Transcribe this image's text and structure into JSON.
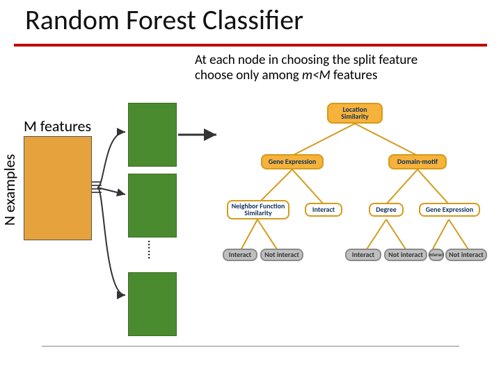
{
  "title": "Random Forest Classifier",
  "subtitle_line1": "At each node in choosing the split feature",
  "subtitle_line2_pre": "choose only among ",
  "subtitle_line2_emph": "m<M",
  "subtitle_line2_post": " features",
  "labels": {
    "m_features": "M features",
    "n_examples": "N examples"
  },
  "tree": {
    "root": "Location\nSimilarity",
    "level1": [
      "Gene Expression",
      "Domain-motif"
    ],
    "level2": [
      "Neighbor\nFunction Similarity",
      "Interact",
      "Degree",
      "Gene Expression"
    ],
    "leaves": [
      "Interact",
      "Not interact",
      "Interact",
      "Not interact",
      "Interact",
      "Not interact"
    ]
  },
  "vdots": "……"
}
